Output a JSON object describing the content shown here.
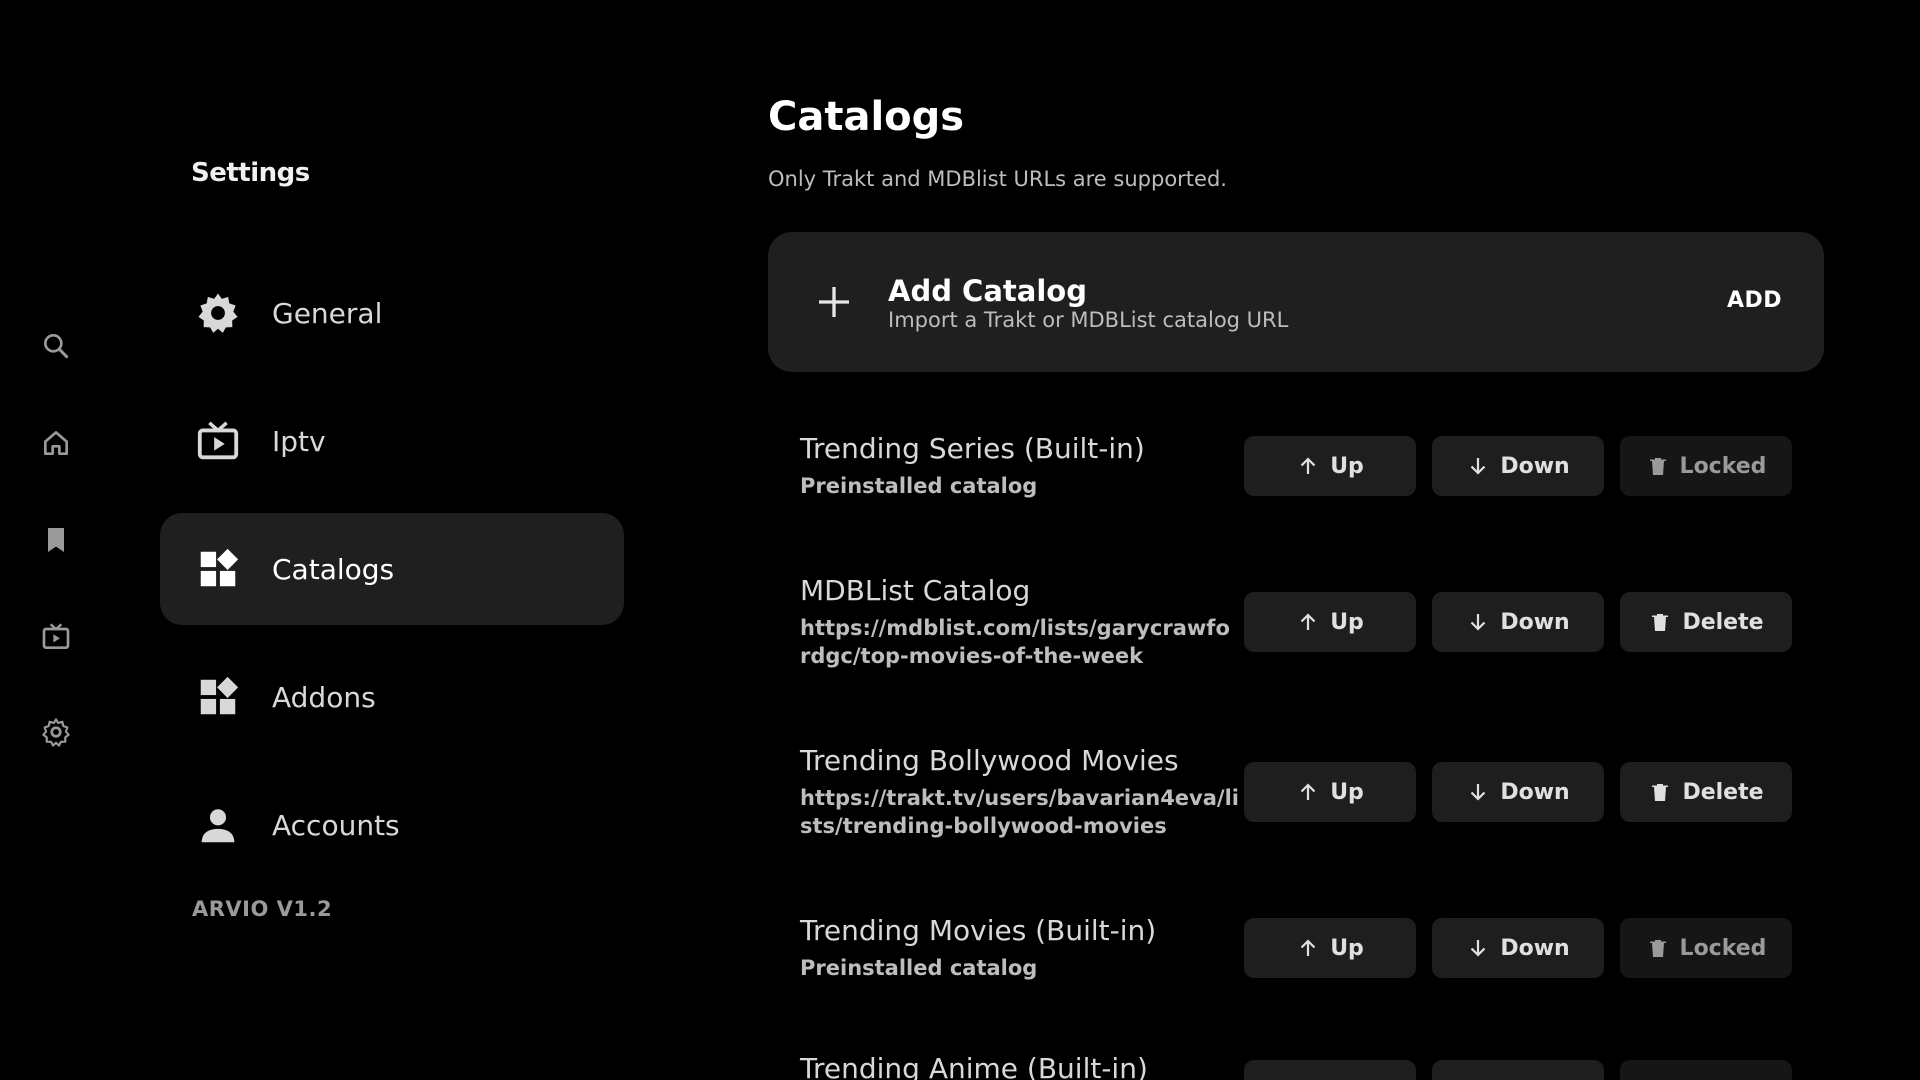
{
  "rail": {
    "icons": [
      "search-icon",
      "home-icon",
      "bookmark-icon",
      "tv-icon",
      "settings-icon"
    ]
  },
  "settings": {
    "title": "Settings",
    "nav": [
      {
        "label": "General",
        "icon": "gear-icon"
      },
      {
        "label": "Iptv",
        "icon": "live-tv-icon"
      },
      {
        "label": "Catalogs",
        "icon": "widgets-icon",
        "active": true
      },
      {
        "label": "Addons",
        "icon": "widgets-icon"
      },
      {
        "label": "Accounts",
        "icon": "person-icon"
      }
    ],
    "version": "ARVIO V1.2"
  },
  "main": {
    "title": "Catalogs",
    "subtitle": "Only Trakt and MDBlist URLs are supported.",
    "add_card": {
      "title": "Add Catalog",
      "description": "Import a Trakt or MDBList catalog URL",
      "action": "ADD"
    },
    "button_labels": {
      "up": "Up",
      "down": "Down",
      "delete": "Delete",
      "locked": "Locked"
    },
    "catalogs": [
      {
        "name": "Trending Series (Built-in)",
        "sub": "Preinstalled catalog",
        "locked": true
      },
      {
        "name": "MDBList Catalog",
        "sub": "https://mdblist.com/lists/garycrawfordgc/top-movies-of-the-week",
        "locked": false
      },
      {
        "name": "Trending Bollywood Movies",
        "sub": "https://trakt.tv/users/bavarian4eva/lists/trending-bollywood-movies",
        "locked": false
      },
      {
        "name": "Trending Movies (Built-in)",
        "sub": "Preinstalled catalog",
        "locked": true
      },
      {
        "name": "Trending Anime (Built-in)",
        "sub": "",
        "locked": true
      }
    ]
  },
  "colors": {
    "background": "#000000",
    "card": "#1f1f1f",
    "button": "#1e1e1e",
    "text_primary": "#ffffff",
    "text_secondary": "#bdbdbd"
  }
}
